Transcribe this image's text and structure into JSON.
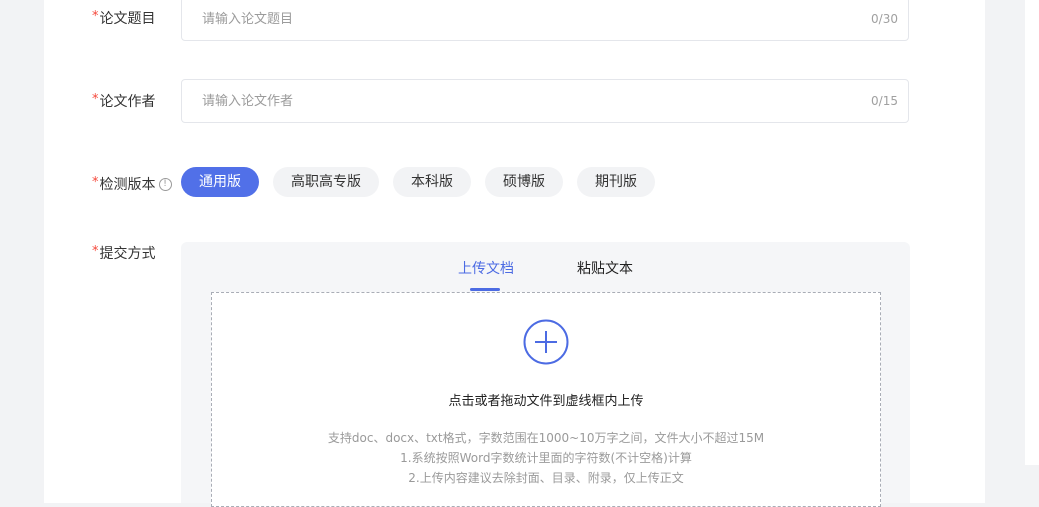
{
  "form": {
    "title_field": {
      "required_mark": "*",
      "label": "论文题目",
      "placeholder": "请输入论文题目",
      "counter": "0/30"
    },
    "author_field": {
      "required_mark": "*",
      "label": "论文作者",
      "placeholder": "请输入论文作者",
      "counter": "0/15"
    },
    "version_field": {
      "required_mark": "*",
      "label": "检测版本",
      "info_glyph": "!",
      "options": [
        "通用版",
        "高职高专版",
        "本科版",
        "硕博版",
        "期刊版"
      ],
      "selected": "通用版"
    },
    "submit_field": {
      "required_mark": "*",
      "label": "提交方式",
      "tabs": [
        "上传文档",
        "粘贴文本"
      ],
      "active_tab": "上传文档",
      "upload": {
        "icon": "plus-circle-icon",
        "main_text": "点击或者拖动文件到虚线框内上传",
        "hints": [
          "支持doc、docx、txt格式，字数范围在1000~10万字之间，文件大小不超过15M",
          "1.系统按照Word字数统计里面的字符数(不计空格)计算",
          "2.上传内容建议去除封面、目录、附录，仅上传正文"
        ]
      }
    }
  },
  "colors": {
    "accent": "#5170e8",
    "required": "#f5483b",
    "background": "#f2f3f5"
  }
}
